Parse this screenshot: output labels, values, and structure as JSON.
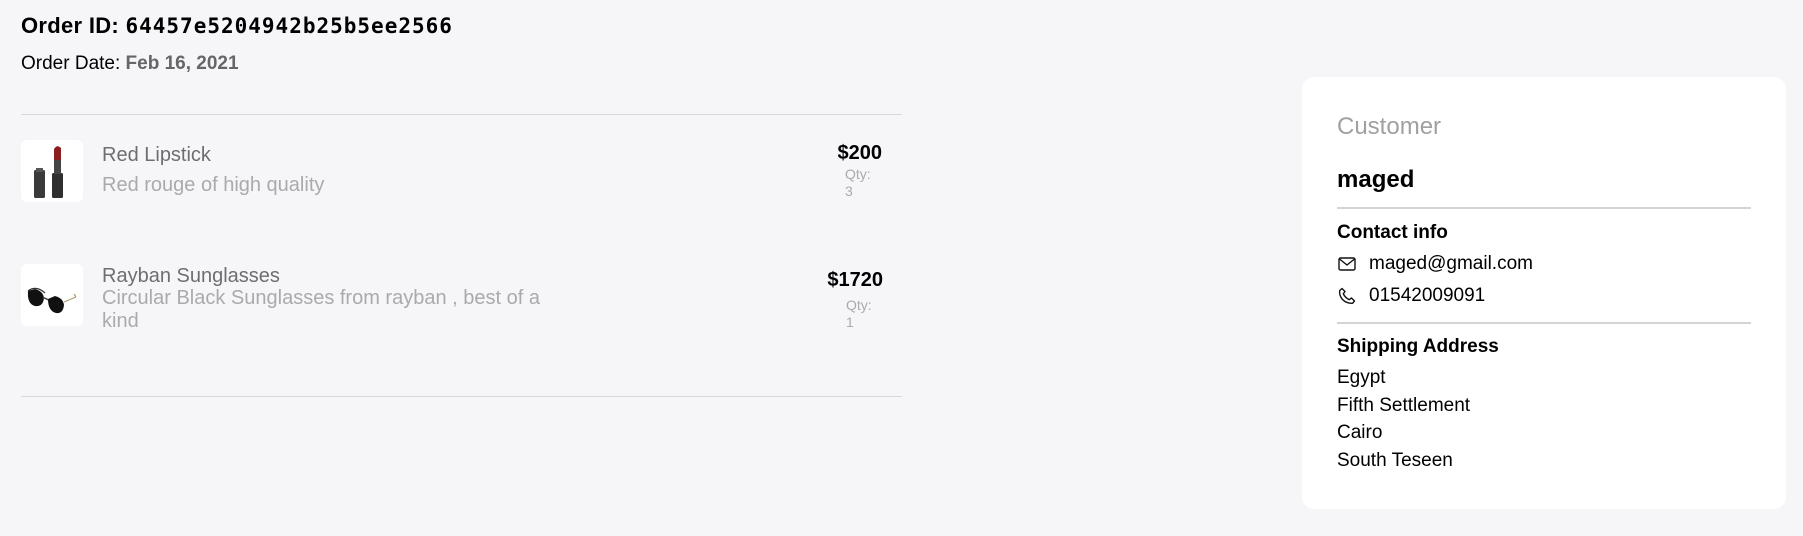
{
  "order": {
    "id_label": "Order ID:",
    "id": "64457e5204942b25b5ee2566",
    "date_label": "Order Date:",
    "date": "Feb 16, 2021"
  },
  "items": [
    {
      "name": "Red Lipstick",
      "description": "Red rouge of high quality",
      "price": "$200",
      "qty_label": "Qty:",
      "qty": "3",
      "image_icon": "lipstick-image"
    },
    {
      "name": "Rayban Sunglasses",
      "description": "Circular Black Sunglasses from rayban , best of a kind",
      "price": "$1720",
      "qty_label": "Qty:",
      "qty": "1",
      "image_icon": "sunglasses-image"
    }
  ],
  "customer": {
    "heading": "Customer",
    "name": "maged",
    "contact_title": "Contact info",
    "email": "maged@gmail.com",
    "phone": "01542009091",
    "email_icon": "mail-icon",
    "phone_icon": "phone-icon",
    "shipping_title": "Shipping Address",
    "address": [
      "Egypt",
      "Fifth Settlement",
      "Cairo",
      "South Teseen"
    ]
  },
  "colors": {
    "background": "#f6f6f9",
    "card": "#ffffff",
    "muted_text": "#aaaaaa",
    "lipstick_red": "#8b1f1f"
  }
}
